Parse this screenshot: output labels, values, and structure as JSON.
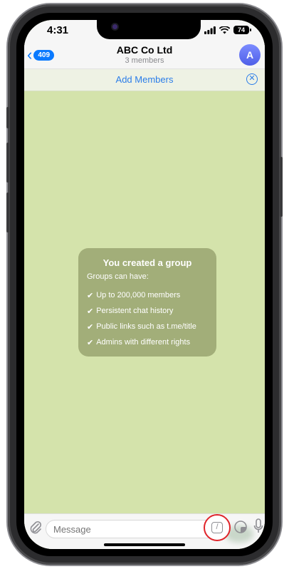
{
  "status_bar": {
    "time": "4:31",
    "battery": "74"
  },
  "header": {
    "back_count": "409",
    "title": "ABC Co Ltd",
    "subtitle": "3 members",
    "avatar_letter": "A"
  },
  "add_bar": {
    "label": "Add Members"
  },
  "service_message": {
    "title": "You created a group",
    "subtitle": "Groups can have:",
    "items": [
      "Up to 200,000 members",
      "Persistent chat history",
      "Public links such as t.me/title",
      "Admins with different rights"
    ]
  },
  "input_bar": {
    "placeholder": "Message"
  },
  "colors": {
    "accent": "#0a7aff",
    "chat_background": "#d4e3ab",
    "highlight_ring": "#e0242a"
  }
}
